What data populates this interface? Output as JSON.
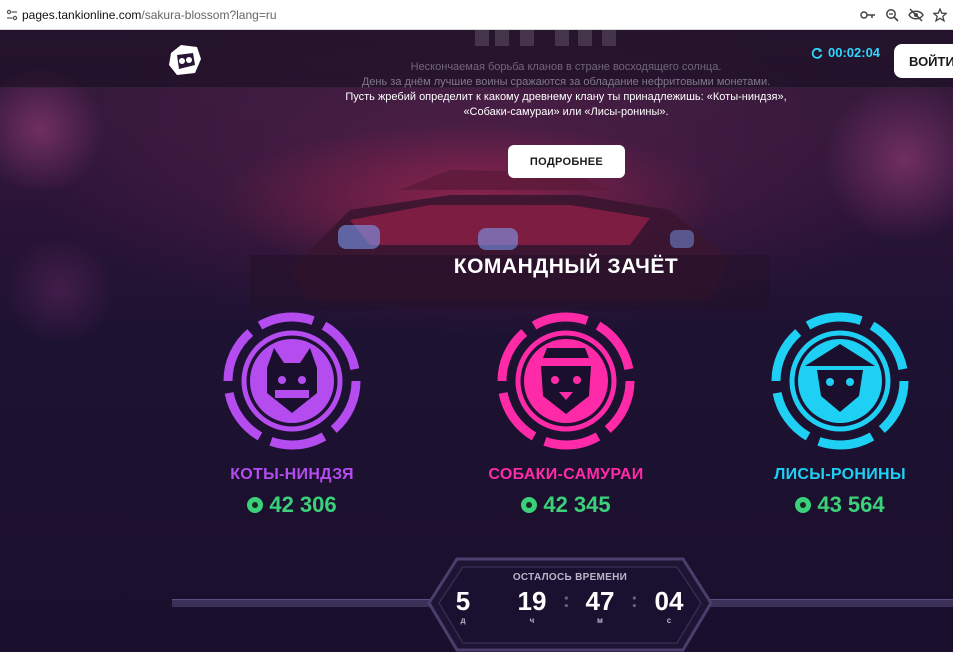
{
  "browser": {
    "url_host": "pages.tankionline.com",
    "url_path": "/sakura-blossom?lang=ru",
    "icons": [
      "site-info-icon",
      "key-icon",
      "zoom-icon",
      "eye-off-icon",
      "star-icon"
    ]
  },
  "header": {
    "timer": "00:02:04",
    "login_label": "ВОЙТИ"
  },
  "hero": {
    "description_line1": "Нескончаемая борьба кланов в стране восходящего солнца.",
    "description_line2": "День за днём лучшие воины сражаются за обладание нефритовыми монетами.",
    "description_line3": "Пусть жребий определит к какому древнему клану ты принадлежишь: «Коты-ниндзя»,",
    "description_line4": "«Собаки-самураи» или «Лисы-ронины».",
    "more_label": "ПОДРОБНЕЕ"
  },
  "scoreboard": {
    "title": "КОМАНДНЫЙ ЗАЧЁТ",
    "clans": [
      {
        "name": "КОТЫ-НИНДЗЯ",
        "score": "42 306",
        "color": "#b44cf0",
        "icon": "cat-ninja-emblem-icon"
      },
      {
        "name": "СОБАКИ-САМУРАИ",
        "score": "42 345",
        "color": "#ff2aa8",
        "icon": "dog-samurai-emblem-icon"
      },
      {
        "name": "ЛИСЫ-РОНИНЫ",
        "score": "43 564",
        "color": "#1fd0f5",
        "icon": "fox-ronin-emblem-icon"
      }
    ],
    "score_color": "#3bd17b"
  },
  "countdown": {
    "label": "ОСТАЛОСЬ ВРЕМЕНИ",
    "days": "5",
    "days_unit": "д",
    "hours": "19",
    "hours_unit": "ч",
    "minutes": "47",
    "minutes_unit": "м",
    "seconds": "04",
    "seconds_unit": "с"
  }
}
